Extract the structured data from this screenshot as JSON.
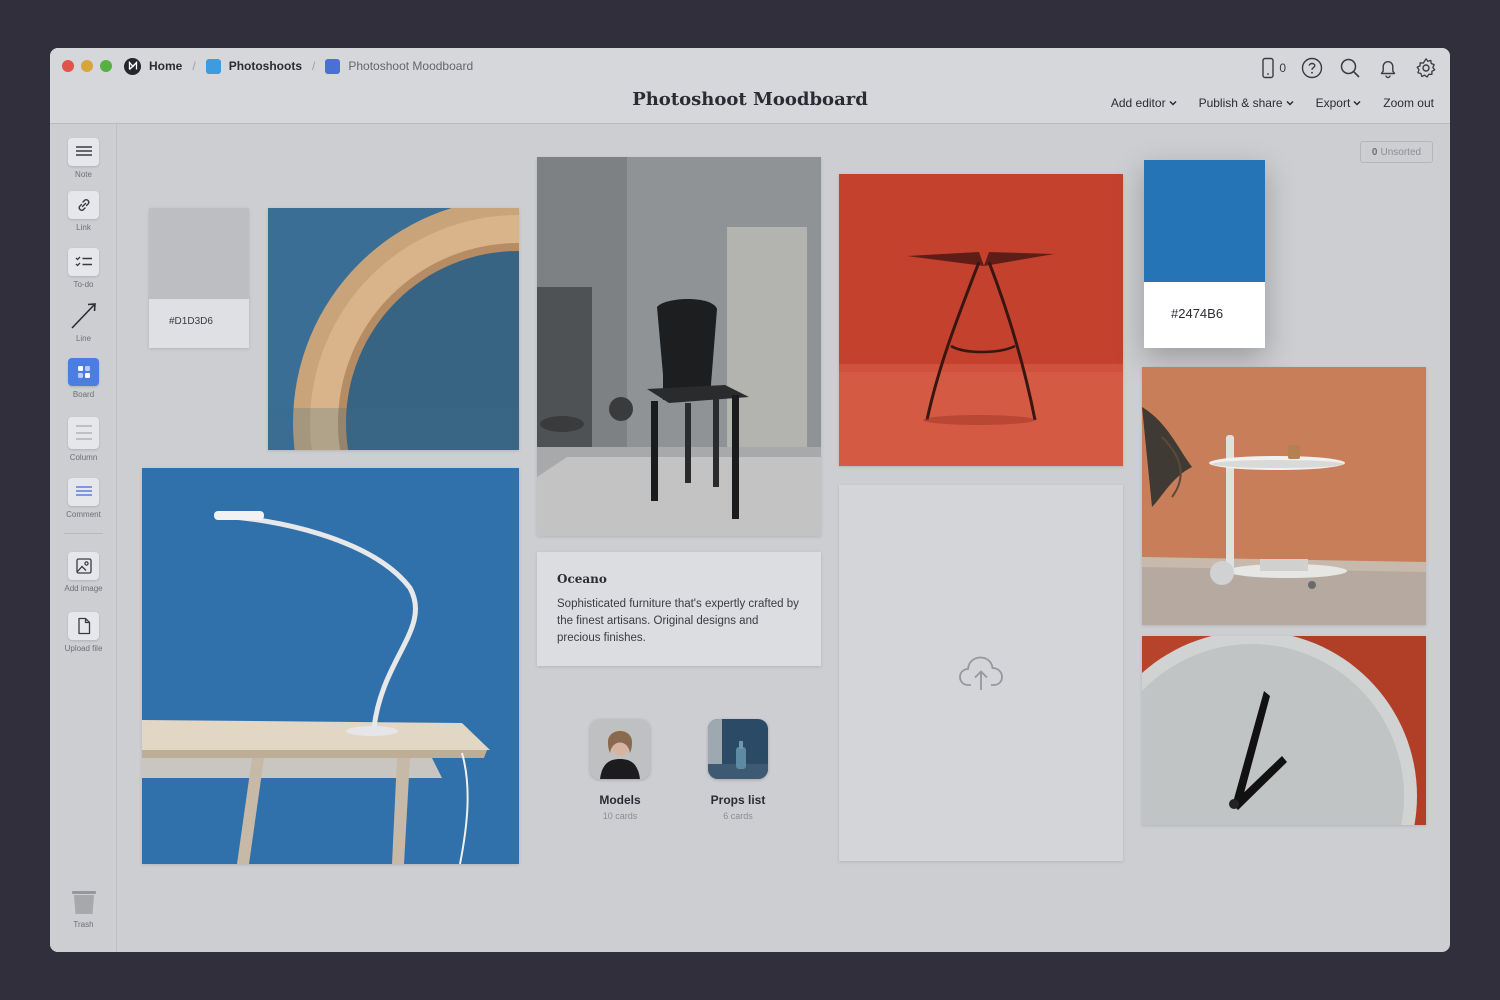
{
  "breadcrumb": {
    "home": "Home",
    "project": "Photoshoots",
    "project_color": "#3d9be0",
    "current": "Photoshoot Moodboard",
    "current_color": "#4a6fd6"
  },
  "board_title": "Photoshoot Moodboard",
  "header": {
    "device_count": "0",
    "menus": [
      "Add editor",
      "Publish & share",
      "Export",
      "Zoom out"
    ]
  },
  "sidebar": {
    "tools": [
      "Note",
      "Link",
      "To-do",
      "Line",
      "Board",
      "Column",
      "Comment",
      "Add image",
      "Upload file"
    ],
    "trash": "Trash"
  },
  "unsorted": {
    "count": "0",
    "label": "Unsorted"
  },
  "swatches": {
    "light": {
      "label": "#D1D3D6",
      "color": "#bdbec2"
    },
    "blue": {
      "label": "#2474B6",
      "color": "#2474b6"
    }
  },
  "note": {
    "title": "Oceano",
    "body": "Sophisticated furniture that's expertly crafted by the finest artisans. Original designs and precious finishes."
  },
  "boards": [
    {
      "name": "Models",
      "count": "10 cards"
    },
    {
      "name": "Props list",
      "count": "6 cards"
    }
  ],
  "images": [
    {
      "icon": "wood-ring-on-blue-image"
    },
    {
      "icon": "desk-lamp-on-blue-image"
    },
    {
      "icon": "black-chair-image"
    },
    {
      "icon": "red-stool-image"
    },
    {
      "icon": "side-table-image"
    },
    {
      "icon": "clock-image"
    }
  ]
}
